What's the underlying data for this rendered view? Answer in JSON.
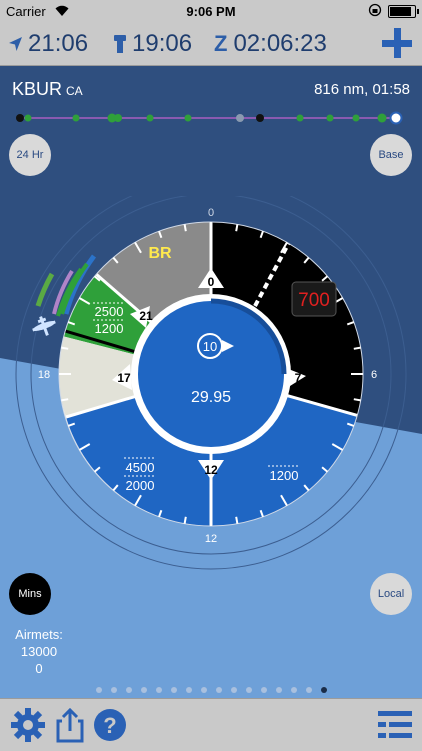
{
  "status": {
    "carrier": "Carrier",
    "time": "9:06 PM"
  },
  "times": {
    "local": "21:06",
    "tower": "19:06",
    "zulu_label": "Z",
    "zulu": "02:06:23"
  },
  "airport": {
    "code": "KBUR",
    "state": "CA",
    "route_info": "816 nm, 01:58"
  },
  "buttons": {
    "hr24": "24 Hr",
    "base": "Base",
    "mins": "Mins",
    "local": "Local"
  },
  "dial": {
    "ring_labels": {
      "north": "0",
      "east": "6",
      "south": "12",
      "west": "18"
    },
    "weather": "BR",
    "ceiling": "700",
    "altimeter": "29.95",
    "wind": "10",
    "runways": {
      "r0": "0",
      "r21": "21",
      "r7": "7",
      "r17": "17",
      "r12": "12"
    },
    "sector_labels": {
      "green_top": "2500",
      "green_bottom": "1200",
      "sw_top": "4500",
      "sw_bottom": "2000",
      "se": "1200"
    }
  },
  "airmets": {
    "label": "Airmets:",
    "line1": "13000",
    "line2": "0"
  },
  "page_dots": {
    "count": 16,
    "active": 15
  },
  "colors": {
    "accent": "#2a61b5",
    "sector_blue": "#1f66c3",
    "vfr_green": "#2fa03a",
    "ceiling_red": "#e02020"
  }
}
